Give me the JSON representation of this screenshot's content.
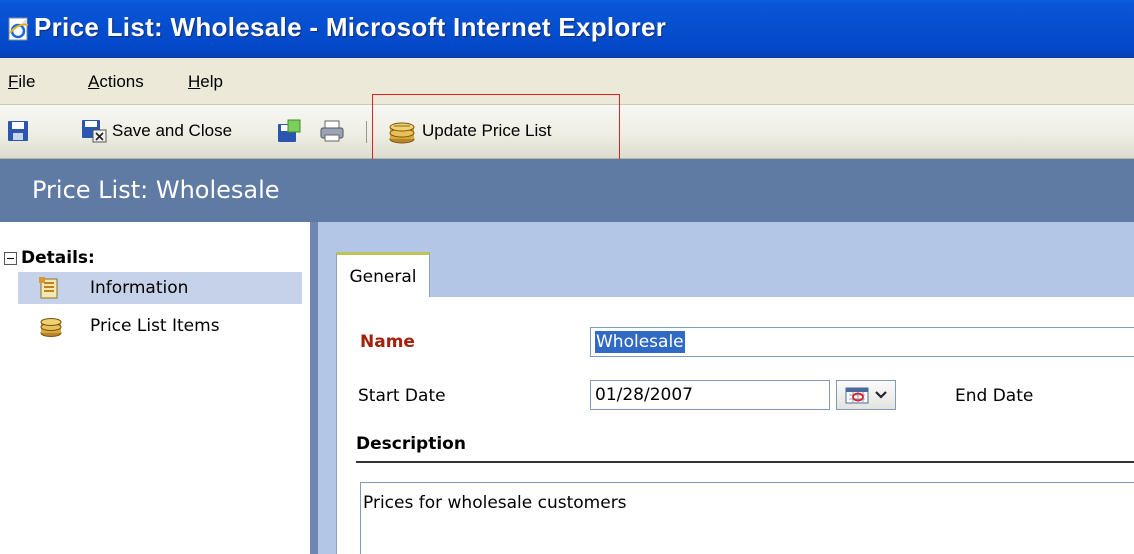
{
  "window": {
    "title": "Price List: Wholesale - Microsoft Internet Explorer"
  },
  "menu": [
    {
      "label": "File",
      "accel": "F",
      "rest": "ile"
    },
    {
      "label": "Actions",
      "accel": "A",
      "rest": "ctions"
    },
    {
      "label": "Help",
      "accel": "H",
      "rest": "elp"
    }
  ],
  "toolbar": {
    "save_and_close_label": "Save and Close",
    "update_price_list_label": "Update Price List"
  },
  "form": {
    "header_title": "Price List: Wholesale"
  },
  "nav": {
    "group_label": "Details:",
    "items": [
      {
        "label": "Information",
        "selected": true
      },
      {
        "label": "Price List Items",
        "selected": false
      }
    ]
  },
  "tabs": [
    {
      "label": "General",
      "active": true
    }
  ],
  "fields": {
    "name_label": "Name",
    "name_value": "Wholesale",
    "start_date_label": "Start Date",
    "start_date_value": "01/28/2007",
    "end_date_label": "End Date",
    "description_section": "Description",
    "description_value": "Prices for wholesale customers"
  },
  "colors": {
    "title_bar": "#0450d0",
    "form_header": "#5f7aa3",
    "required_label": "#a3200c",
    "highlight_box": "#e02020",
    "selected_nav": "#c6d2ea"
  }
}
